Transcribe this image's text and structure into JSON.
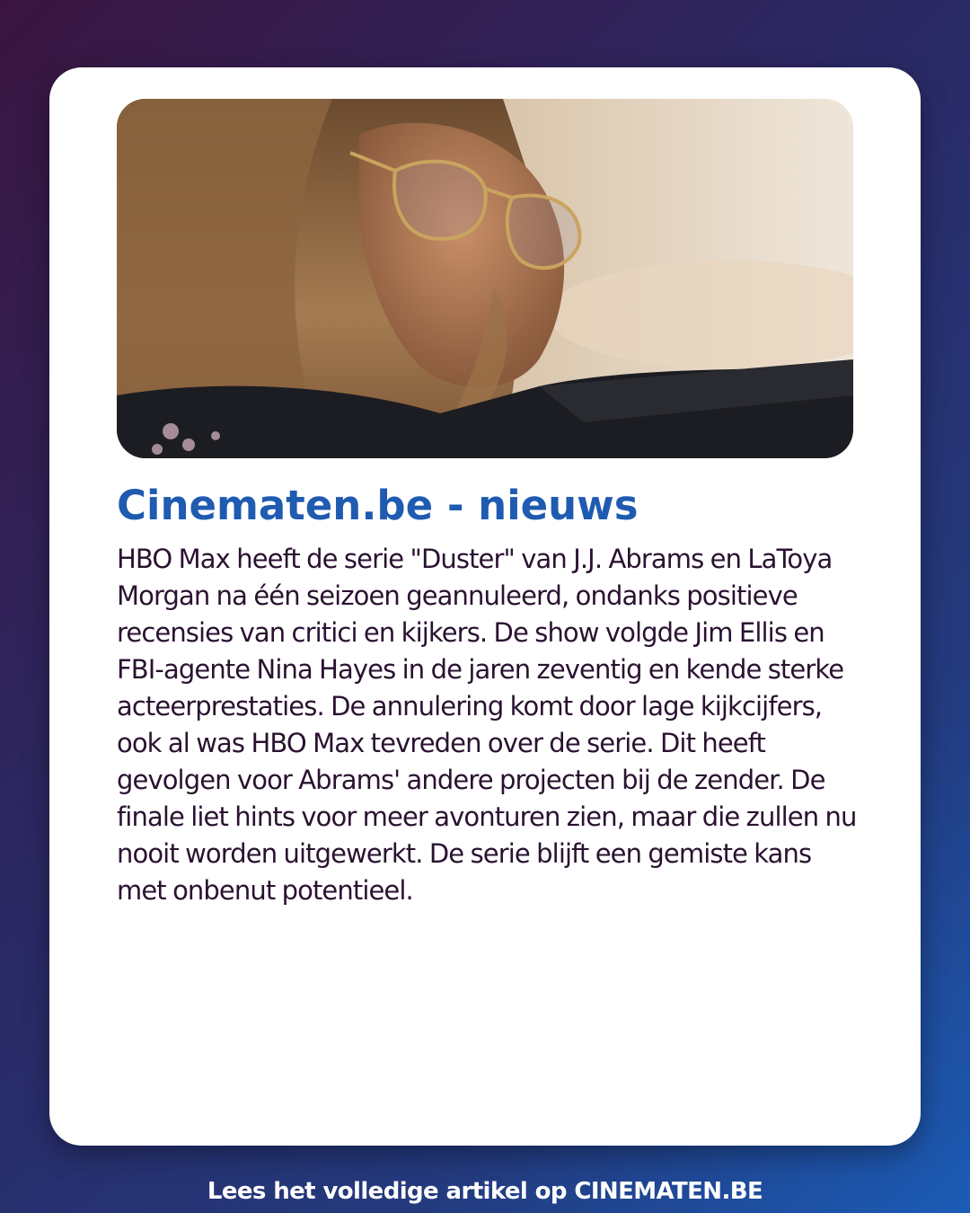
{
  "card": {
    "image": {
      "description_icon": "portrait-photo-icon"
    },
    "headline": "Cinematen.be - nieuws",
    "body": "HBO Max heeft de serie \"Duster\" van J.J. Abrams en LaToya Morgan na één seizoen geannuleerd, ondanks positieve recensies van critici en kijkers. De show volgde Jim Ellis en FBI-agente Nina Hayes in de jaren zeventig en kende sterke acteerprestaties. De annulering komt door lage kijkcijfers, ook al was HBO Max tevreden over de serie. Dit heeft gevolgen voor Abrams' andere projecten bij de zender. De finale liet hints voor meer avonturen zien, maar die zullen nu nooit worden uitgewerkt. De serie blijft een gemiste kans met onbenut potentieel."
  },
  "footer": {
    "text": "Lees het volledige artikel op CINEMATEN.BE"
  },
  "colors": {
    "headline": "#1f5bb0",
    "body_text": "#2a1230",
    "card": "#ffffff",
    "background_start": "#3a1540",
    "background_end": "#1b5cb6"
  }
}
